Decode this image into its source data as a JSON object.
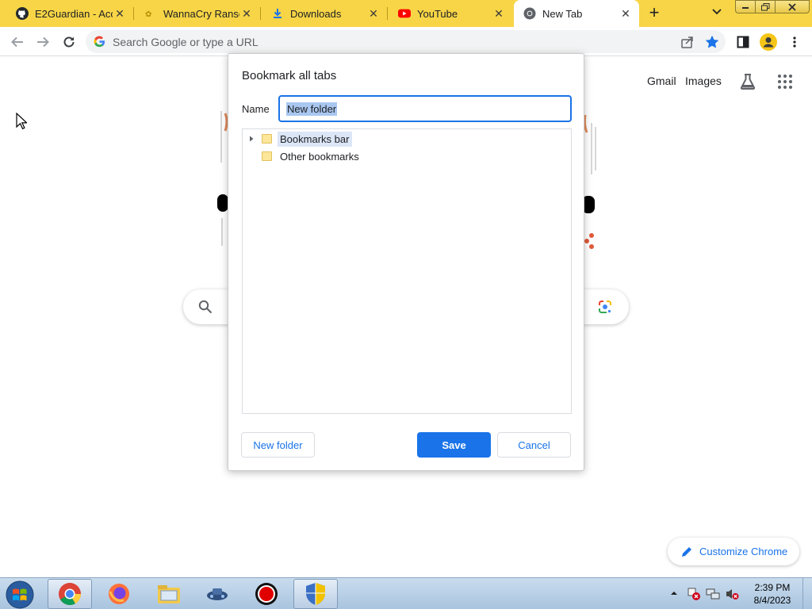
{
  "tabs": [
    {
      "title": "E2Guardian - Acce",
      "icon": "github-icon",
      "close": "✕"
    },
    {
      "title": "WannaCry Ransom",
      "icon": "wannacry-icon",
      "close": "✕"
    },
    {
      "title": "Downloads",
      "icon": "download-icon",
      "close": "✕"
    },
    {
      "title": "YouTube",
      "icon": "youtube-icon",
      "close": "✕"
    },
    {
      "title": "New Tab",
      "icon": "chrome-icon",
      "close": "✕",
      "active": true
    }
  ],
  "new_tab_label": "+",
  "omnibox": {
    "placeholder": "Search Google or type a URL",
    "value": ""
  },
  "ntp": {
    "gmail": "Gmail",
    "images": "Images",
    "customize": "Customize Chrome"
  },
  "dialog": {
    "title": "Bookmark all tabs",
    "name_label": "Name",
    "name_value": "New folder",
    "tree": [
      {
        "label": "Bookmarks bar",
        "expandable": true,
        "selected": true
      },
      {
        "label": "Other bookmarks",
        "expandable": false,
        "selected": false
      }
    ],
    "buttons": {
      "new_folder": "New folder",
      "save": "Save",
      "cancel": "Cancel"
    }
  },
  "taskbar": {
    "apps": [
      "chrome-icon",
      "firefox-icon",
      "file-explorer-icon",
      "network-game-icon",
      "record-icon",
      "shield-icon"
    ],
    "clock_time": "2:39 PM",
    "clock_date": "8/4/2023"
  },
  "colors": {
    "tabstrip": "#f7d546",
    "accent": "#1a73e8",
    "taskbar": "#b9cfe6"
  }
}
